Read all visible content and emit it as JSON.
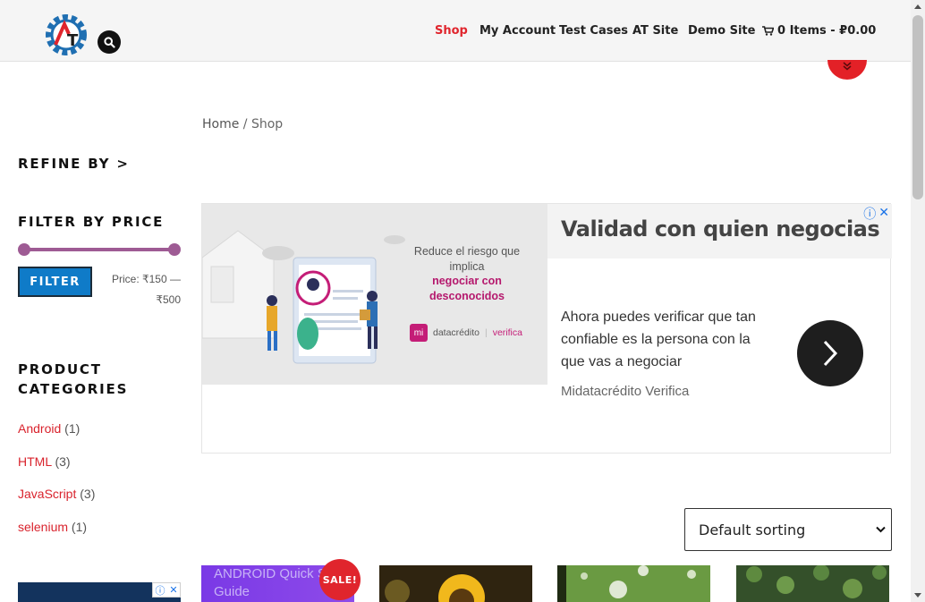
{
  "header": {
    "logo_text": "AT",
    "nav": [
      {
        "label": "Shop",
        "active": true
      },
      {
        "label": "My Account"
      },
      {
        "label": "Test Cases"
      },
      {
        "label": "AT Site"
      },
      {
        "label": "Demo Site"
      }
    ],
    "cart_label": "0 Items - ₽0.00",
    "icons": [
      "search-icon",
      "cart-icon",
      "double-chevron-down-icon"
    ],
    "accent_color": "#e0252d"
  },
  "breadcrumb": {
    "home": "Home",
    "separator": "/",
    "current": "Shop"
  },
  "sidebar": {
    "refine_title": "REFINE BY >",
    "filter_title": "FILTER BY PRICE",
    "filter_button": "FILTER",
    "price_label": "Price: ₹150 — ₹500",
    "price_min": "₹150",
    "price_max": "₹500",
    "categories_title": "PRODUCT CATEGORIES",
    "categories": [
      {
        "name": "Android",
        "count": "(1)"
      },
      {
        "name": "HTML",
        "count": "(3)"
      },
      {
        "name": "JavaScript",
        "count": "(3)"
      },
      {
        "name": "selenium",
        "count": "(1)"
      }
    ]
  },
  "ad": {
    "headline": "Validad con quien negocias",
    "body": "Ahora puedes verificar que tan confiable es la persona con la que vas a negociar",
    "source": "Midatacrédito Verifica",
    "image_text_1": "Reduce el riesgo que implica",
    "image_text_2": "negociar con desconocidos",
    "brand_mi": "mi",
    "brand_name": "datacrédito",
    "brand_verifica": "verifica"
  },
  "sorting": {
    "selected": "Default sorting"
  },
  "products": {
    "p1_text": "ANDROID Quick Start Guide",
    "sale_badge": "SALE!"
  }
}
